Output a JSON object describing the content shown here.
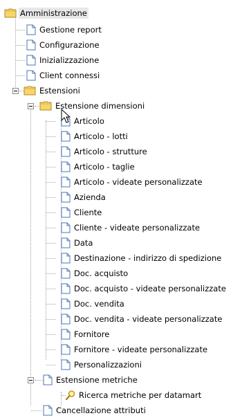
{
  "tree": {
    "root_label": "Amministrazione",
    "items": [
      "Gestione report",
      "Configurazione",
      "Inizializzazione",
      "Client connessi",
      "Estensioni",
      "Estensione dimensioni",
      "Articolo",
      "Articolo - lotti",
      "Articolo - strutture",
      "Articolo - taglie",
      "Articolo - videate personalizzate",
      "Azienda",
      "Cliente",
      "Cliente - videate personalizzate",
      "Data",
      "Destinazione - indirizzo di spedizione",
      "Doc. acquisto",
      "Doc. acquisto - videate personalizzate",
      "Doc. vendita",
      "Doc. vendita - videate personalizzate",
      "Fornitore",
      "Fornitore - videate personalizzate",
      "Personalizzazioni",
      "Estensione metriche",
      "Ricerca metriche per datamart",
      "Cancellazione attributi"
    ]
  },
  "icons": {
    "folder": "folder-icon",
    "document": "document-icon",
    "search": "magnifier-icon",
    "cursor": "mouse-cursor"
  },
  "colors": {
    "folder_fill": "#f7d56b",
    "folder_edge": "#b08a22",
    "doc_edge": "#4b74b6",
    "selected_bg": "#e8e8e8"
  }
}
